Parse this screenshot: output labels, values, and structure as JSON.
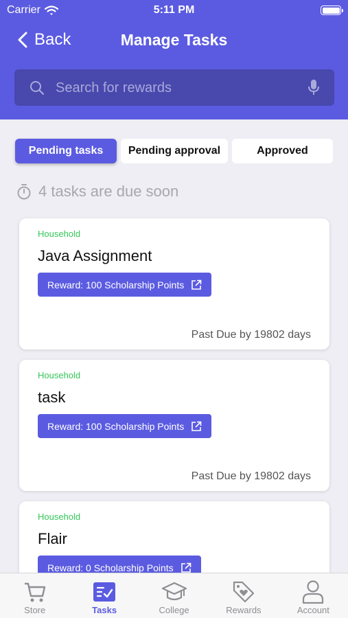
{
  "status_bar": {
    "carrier": "Carrier",
    "time": "5:11 PM"
  },
  "nav": {
    "back_label": "Back",
    "title": "Manage Tasks"
  },
  "search": {
    "placeholder": "Search for rewards"
  },
  "tabs": [
    {
      "label": "Pending tasks",
      "active": true
    },
    {
      "label": "Pending approval",
      "active": false
    },
    {
      "label": "Approved",
      "active": false
    }
  ],
  "due_notice": "4 tasks are due soon",
  "tasks": [
    {
      "category": "Household",
      "name": "Java Assignment",
      "reward": "Reward: 100 Scholarship Points",
      "due": "Past Due by 19802 days"
    },
    {
      "category": "Household",
      "name": "task",
      "reward": "Reward: 100 Scholarship Points",
      "due": "Past Due by 19802 days"
    },
    {
      "category": "Household",
      "name": "Flair",
      "reward": "Reward: 0 Scholarship Points",
      "due": ""
    }
  ],
  "tab_bar": [
    {
      "label": "Store",
      "icon": "cart-icon",
      "active": false
    },
    {
      "label": "Tasks",
      "icon": "tasks-icon",
      "active": true
    },
    {
      "label": "College",
      "icon": "graduation-cap-icon",
      "active": false
    },
    {
      "label": "Rewards",
      "icon": "tag-heart-icon",
      "active": false
    },
    {
      "label": "Account",
      "icon": "person-icon",
      "active": false
    }
  ],
  "colors": {
    "brand": "#5b5be1",
    "search_bg": "#4848ad",
    "category": "#34c759",
    "background": "#eeeef4"
  }
}
